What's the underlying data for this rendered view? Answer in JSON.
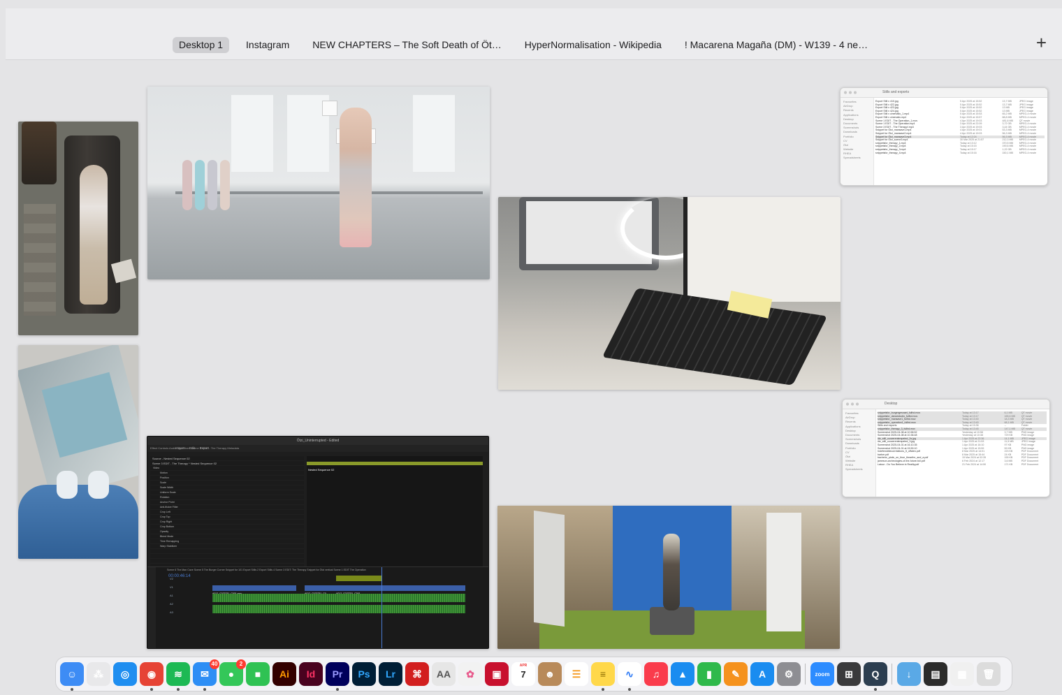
{
  "spaces_bar": {
    "tabs": [
      {
        "label": "Desktop 1",
        "active": true
      },
      {
        "label": "Instagram",
        "active": false
      },
      {
        "label": "NEW CHAPTERS – The Soft Death of Öt…",
        "active": false
      },
      {
        "label": "HyperNormalisation - Wikipedia",
        "active": false
      },
      {
        "label": "! Macarena Magaña (DM) - W139 - 4 ne…",
        "active": false
      }
    ],
    "add_label": "+"
  },
  "finder_top": {
    "title": "Stills and exports",
    "sidebar": [
      "Favourites",
      "AirDrop",
      "Recents",
      "Applications",
      "Desktop",
      "Documents",
      "Screenshots",
      "Downloads",
      "Portfolio",
      "CV",
      "Ötzi",
      "Website",
      "RHEA",
      "Spreadsheets"
    ],
    "rows": [
      {
        "name": "Export Still x 410.jpg",
        "date": "5 Apr 2025 at 15:52",
        "size": "13,7 MB",
        "kind": "JPEG image"
      },
      {
        "name": "Export Still x 422.jpg",
        "date": "5 Apr 2025 at 15:52",
        "size": "13,7 MB",
        "kind": "JPEG image"
      },
      {
        "name": "Export Still x 423.jpg",
        "date": "5 Apr 2025 at 15:52",
        "size": "13 MB",
        "kind": "JPEG image"
      },
      {
        "name": "Export Still x 424.jpg",
        "date": "5 Apr 2025 at 15:52",
        "size": "13 MB",
        "kind": "JPEG image"
      },
      {
        "name": "Export Still x cinematic_1.mp4",
        "date": "5 Apr 2025 at 15:53",
        "size": "65,2 MB",
        "kind": "MPEG-4 movie"
      },
      {
        "name": "Export Still x cinematic.mp4",
        "date": "5 Apr 2025 at 15:57",
        "size": "88,8 MB",
        "kind": "MPEG-4 movie"
      },
      {
        "name": "Scene 1 EDIT - The Operation_1.mov",
        "date": "4 Apr 2025 at 19:03",
        "size": "481,6 MB",
        "kind": "QT movie"
      },
      {
        "name": "Scene 1 EDIT - The Operation.mp4",
        "date": "3 Apr 2025 at 22:09",
        "size": "3,72 GB",
        "kind": "MPEG-4 movie"
      },
      {
        "name": "Scene 3 EDIT - The Therapy!.mp4",
        "date": "3 Apr 2025 at 19:03",
        "size": "3,44 GB",
        "kind": "MPEG-4 movie"
      },
      {
        "name": "Snippet for Ötzi_mansave1.mp4",
        "date": "4 Apr 2025 at 19:01",
        "size": "53,3 MB",
        "kind": "MPEG-4 movie"
      },
      {
        "name": "Snippet for Ötzi_mansave2.mp4",
        "date": "4 Apr 2025 at 19:03",
        "size": "56,3 MB",
        "kind": "MPEG-4 movie"
      },
      {
        "name": "Snippet for Ötzi_mansave3.mp4",
        "date": "Today at 12:24",
        "size": "56,3 MB",
        "kind": "MPEG-4 movie",
        "sel": true
      },
      {
        "name": "Snippet for Ötzi_scene3.mp4",
        "date": "30 Mar 2025 at 21:57",
        "size": "212,3 MB",
        "kind": "MPEG-4 movie"
      },
      {
        "name": "snippetsfor_therapy_1.mp4",
        "date": "Today at 13:12",
        "size": "370,5 MB",
        "kind": "MPEG-4 movie"
      },
      {
        "name": "snippetsfor_therapy_2.mp4",
        "date": "Today at 15:15",
        "size": "190,6 MB",
        "kind": "MPEG-4 movie"
      },
      {
        "name": "snippetsfor_therapy_3.mp4",
        "date": "Today at 15:17",
        "size": "1,22 GB",
        "kind": "MPEG-4 movie"
      },
      {
        "name": "snippetsfor_therapy_4.mp4",
        "date": "Today at 15:16",
        "size": "150,1 MB",
        "kind": "MPEG-4 movie"
      }
    ]
  },
  "finder_bottom": {
    "title": "Desktop",
    "sidebar": [
      "Favourites",
      "AirDrop",
      "Recents",
      "Applications",
      "Desktop",
      "Documents",
      "Screenshots",
      "Downloads",
      "Portfolio",
      "CV",
      "Ötzi",
      "Website",
      "RHEA",
      "Spreadsheets"
    ],
    "rows": [
      {
        "name": "snippetsfor_burgergesnaet_fullhd.mov",
        "date": "Today at 13:17",
        "size": "6,1 MB",
        "kind": "QT movie",
        "sel": true
      },
      {
        "name": "snippetsfor_dancestudio_fullhd.mov",
        "date": "Today at 13:17",
        "size": "165,6 MB",
        "kind": "QT movie",
        "sel": true
      },
      {
        "name": "snippetsfor_mansave1_fullhd.mov",
        "date": "Today at 13:40",
        "size": "18,3 MB",
        "kind": "QT movie",
        "sel": true
      },
      {
        "name": "snippetsfor_operation1_fullhd.mov",
        "date": "Today at 13:40",
        "size": "68,1 MB",
        "kind": "QT movie",
        "sel": true
      },
      {
        "name": "Stills and exports",
        "date": "Today at 15:36",
        "size": "--",
        "kind": "Folder"
      },
      {
        "name": "snippetsfor_therapy_3_fullhd.mov",
        "date": "Today at 13:45",
        "size": "147,1 MB",
        "kind": "QT movie",
        "sel": true
      },
      {
        "name": "Screenshot 2025-04-08 at 10.58.52",
        "date": "Yesterday at 10:58",
        "size": "3,7 MB",
        "kind": "PNG image"
      },
      {
        "name": "Screenshot 2025-04-08 at 10.38.48",
        "date": "Yesterday at 10:38",
        "size": "729 KB",
        "kind": "PNG image"
      },
      {
        "name": "ötz_still_ccoverenterspeled_2s.jpg",
        "date": "1 Apr 2025 at 22:36",
        "size": "14,1 MB",
        "kind": "JPEG image",
        "sel": true
      },
      {
        "name": "ötz_still_ccoverenterspeled_3.jpg",
        "date": "1 Apr 2025 at 21:53",
        "size": "11,5 MB",
        "kind": "JPEG image"
      },
      {
        "name": "Screenshot 2025-04-01 at 16.10.35",
        "date": "1 Apr 2025 at 16:10",
        "size": "97 KB",
        "kind": "PNG image"
      },
      {
        "name": "Screenshot 2025-04-01 at 15.59.10",
        "date": "1 Apr 2025 at 15:59",
        "size": "59 KB",
        "kind": "PNG image"
      },
      {
        "name": "Indefensiblecorrelations_5_offaten.pdf",
        "date": "8 Mar 2025 at 14:01",
        "size": "223 KB",
        "kind": "PDF Document"
      },
      {
        "name": "barber.pdf",
        "date": "8 Mar 2025 at 15:44",
        "size": "24 KB",
        "kind": "PDF Document"
      },
      {
        "name": "bachelor_plotic_on_thue_thearthn_and_a.pdf",
        "date": "15 Mar 2024 at 02:35",
        "size": "155 KB",
        "kind": "PDF Document"
      },
      {
        "name": "jameson-archeologies-of-the-future-full.pdf",
        "date": "6 Feb 2024 at 12:17",
        "size": "3,6 MB",
        "kind": "PDF Document"
      },
      {
        "name": "Latour - Do You Believe in Reality.pdf",
        "date": "21 Feb 2024 at 14:50",
        "size": "171 KB",
        "kind": "PDF Document"
      }
    ]
  },
  "premiere": {
    "title": "Ötzi_Uninterrupted - Edited",
    "menu": "Import Edit Export",
    "panels": "Effect Controls   Audio Clip Mixer: Scene 3 EDIT - The Therapy   Metadata",
    "source_label": "Source - Nested Sequence 02",
    "sequence_label": "Scene 3 EDIT - The Therapy * Nested Sequence 02",
    "clip_label": "Nested Sequence 02",
    "timecode": "00:00:46:14",
    "tabs": "Scene 6 The Man Cave   Scene 5 The Burger Corner   Snippet for 101   Export Stills 2   Export Stills 4   Scene 3 EDIT: The Therapy   Snippet for Ötzi vertical   Scene 1 EDIT The Operation",
    "effect_rows": [
      "Video",
      "Motion",
      "Position",
      "Scale",
      "Scale Width",
      "Uniform Scale",
      "Rotation",
      "Anchor Point",
      "Anti-flicker Filter",
      "Crop Left",
      "Crop Top",
      "Crop Right",
      "Crop Bottom",
      "Opacity",
      "Blend Mode",
      "Time Remapping",
      "Warp Stabilizer"
    ],
    "video_clip_labels": [
      "A012_C022231_C001.mov",
      "A012_C022231_C0...",
      "A012_C022231_C001..."
    ],
    "track_labels": [
      "V2",
      "V1",
      "A1",
      "A2",
      "A3"
    ]
  },
  "dock": {
    "apps": [
      {
        "name": "Finder",
        "icon": "finder-icon",
        "color": "#3d8cf5",
        "glyph": "☺",
        "running": true
      },
      {
        "name": "Launchpad",
        "icon": "launchpad-icon",
        "color": "#e8e8ea",
        "glyph": "⁂",
        "running": false
      },
      {
        "name": "Safari",
        "icon": "safari-icon",
        "color": "#1f8ef0",
        "glyph": "◎",
        "running": false
      },
      {
        "name": "Chrome",
        "icon": "chrome-icon",
        "color": "#e64335",
        "glyph": "◉",
        "running": true
      },
      {
        "name": "Spotify",
        "icon": "spotify-icon",
        "color": "#1db954",
        "glyph": "≋",
        "running": true
      },
      {
        "name": "Mail",
        "icon": "mail-icon",
        "color": "#2d8ef5",
        "glyph": "✉",
        "running": true,
        "badge": "40"
      },
      {
        "name": "Messages",
        "icon": "messages-icon",
        "color": "#34c759",
        "glyph": "●",
        "running": false,
        "badge": "2"
      },
      {
        "name": "FaceTime",
        "icon": "facetime-icon",
        "color": "#2fc253",
        "glyph": "■",
        "running": false
      },
      {
        "name": "Illustrator",
        "icon": "illustrator-icon",
        "color": "#330000",
        "glyph": "Ai",
        "running": false,
        "fg": "#ff9a00"
      },
      {
        "name": "InDesign",
        "icon": "indesign-icon",
        "color": "#49021f",
        "glyph": "Id",
        "running": false,
        "fg": "#ff3366"
      },
      {
        "name": "Premiere Pro",
        "icon": "premiere-icon",
        "color": "#00005b",
        "glyph": "Pr",
        "running": true,
        "fg": "#9999ff"
      },
      {
        "name": "Photoshop",
        "icon": "photoshop-icon",
        "color": "#001e36",
        "glyph": "Ps",
        "running": false,
        "fg": "#31a8ff"
      },
      {
        "name": "Lightroom",
        "icon": "lightroom-icon",
        "color": "#001e36",
        "glyph": "Lr",
        "running": false,
        "fg": "#31a8ff"
      },
      {
        "name": "Acrobat",
        "icon": "acrobat-icon",
        "color": "#d21f1f",
        "glyph": "⌘",
        "running": false
      },
      {
        "name": "Font Book",
        "icon": "fontbook-icon",
        "color": "#e6e6e6",
        "glyph": "AA",
        "running": false,
        "fg": "#555"
      },
      {
        "name": "Photos",
        "icon": "photos-icon",
        "color": "#f2f2f2",
        "glyph": "✿",
        "running": false,
        "fg": "#e85a8c"
      },
      {
        "name": "Photo Booth",
        "icon": "photobooth-icon",
        "color": "#c8102e",
        "glyph": "▣",
        "running": false
      },
      {
        "name": "Calendar",
        "icon": "calendar-icon",
        "color": "#ffffff",
        "glyph": "7",
        "running": false,
        "fg": "#222",
        "month": "APR"
      },
      {
        "name": "Contacts",
        "icon": "contacts-icon",
        "color": "#b88a5a",
        "glyph": "☻",
        "running": false
      },
      {
        "name": "Reminders",
        "icon": "reminders-icon",
        "color": "#ffffff",
        "glyph": "☰",
        "running": false,
        "fg": "#f59b23"
      },
      {
        "name": "Notes",
        "icon": "notes-icon",
        "color": "#ffd84a",
        "glyph": "≡",
        "running": true,
        "fg": "#8a6a00"
      },
      {
        "name": "Freeform",
        "icon": "freeform-icon",
        "color": "#ffffff",
        "glyph": "∿",
        "running": true,
        "fg": "#2f7bf5"
      },
      {
        "name": "Music",
        "icon": "music-icon",
        "color": "#fa3c4c",
        "glyph": "♫",
        "running": false
      },
      {
        "name": "Keynote",
        "icon": "keynote-icon",
        "color": "#1a8cf0",
        "glyph": "▲",
        "running": false
      },
      {
        "name": "Numbers",
        "icon": "numbers-icon",
        "color": "#2fb94b",
        "glyph": "▮",
        "running": false
      },
      {
        "name": "Pages",
        "icon": "pages-icon",
        "color": "#f5921e",
        "glyph": "✎",
        "running": false
      },
      {
        "name": "App Store",
        "icon": "appstore-icon",
        "color": "#1a8cf0",
        "glyph": "A",
        "running": false
      },
      {
        "name": "System Settings",
        "icon": "settings-icon",
        "color": "#8e8e93",
        "glyph": "⚙",
        "running": false
      },
      {
        "name": "Zoom",
        "icon": "zoom-icon",
        "color": "#2d8cff",
        "glyph": "zoom",
        "running": false,
        "small": true
      },
      {
        "name": "Calculator",
        "icon": "calculator-icon",
        "color": "#3a3a3c",
        "glyph": "⊞",
        "running": false
      },
      {
        "name": "QuickTime",
        "icon": "quicktime-icon",
        "color": "#2c3e50",
        "glyph": "Q",
        "running": true
      }
    ],
    "folders": [
      {
        "name": "Downloads",
        "icon": "downloads-folder-icon",
        "color": "#5aa9e6",
        "glyph": "↓"
      },
      {
        "name": "Desktop Stack",
        "icon": "desktop-stack-icon",
        "color": "#2b2b2b",
        "glyph": "▤"
      },
      {
        "name": "Documents Stack",
        "icon": "documents-stack-icon",
        "color": "#f0f0f0",
        "glyph": "▦"
      },
      {
        "name": "Trash",
        "icon": "trash-icon",
        "color": "#dcdcdc",
        "glyph": "🗑"
      }
    ]
  }
}
